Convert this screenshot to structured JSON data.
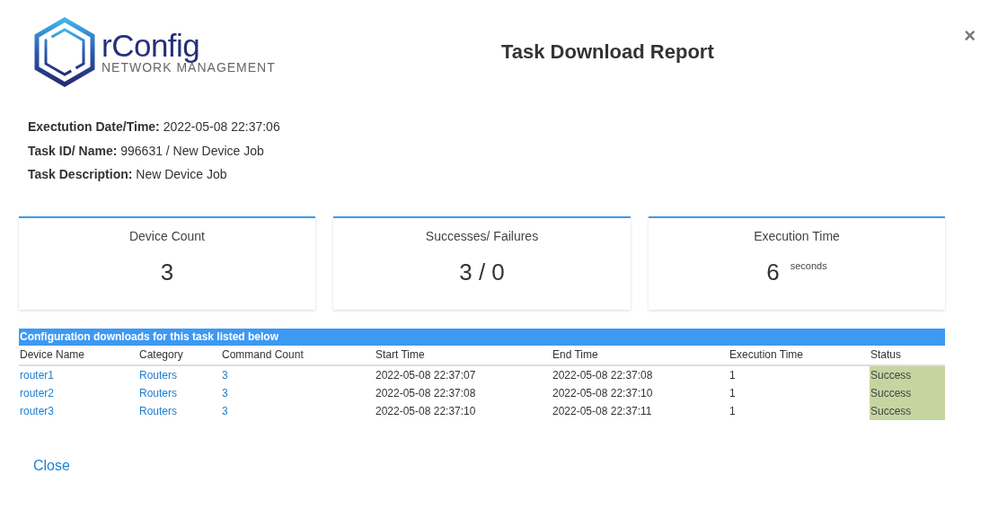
{
  "logo": {
    "name": "rConfig",
    "tagline": "NETWORK MANAGEMENT"
  },
  "title": "Task Download Report",
  "close_icon": "×",
  "details": [
    {
      "label": "Exectution Date/Time:",
      "value": "2022-05-08 22:37:06"
    },
    {
      "label": "Task ID/ Name:",
      "value": "996631 / New Device Job"
    },
    {
      "label": "Task Description:",
      "value": "New Device Job"
    }
  ],
  "stats": [
    {
      "label": "Device Count",
      "value": "3"
    },
    {
      "label": "Successes/ Failures",
      "value": "3 / 0"
    },
    {
      "label": "Execution Time",
      "value": "6",
      "unit": "seconds"
    }
  ],
  "table": {
    "caption": "Configuration downloads for this task listed below",
    "columns": [
      {
        "label": "Device Name",
        "kind": "link"
      },
      {
        "label": "Category",
        "kind": "link"
      },
      {
        "label": "Command Count",
        "kind": "link"
      },
      {
        "label": "Start Time",
        "kind": "text"
      },
      {
        "label": "End Time",
        "kind": "text"
      },
      {
        "label": "Execution Time",
        "kind": "text"
      },
      {
        "label": "Status",
        "kind": "status"
      }
    ],
    "rows": [
      [
        "router1",
        "Routers",
        "3",
        "2022-05-08 22:37:07",
        "2022-05-08 22:37:08",
        "1",
        "Success"
      ],
      [
        "router2",
        "Routers",
        "3",
        "2022-05-08 22:37:08",
        "2022-05-08 22:37:10",
        "1",
        "Success"
      ],
      [
        "router3",
        "Routers",
        "3",
        "2022-05-08 22:37:10",
        "2022-05-08 22:37:11",
        "1",
        "Success"
      ]
    ]
  },
  "footer_link": "Close"
}
